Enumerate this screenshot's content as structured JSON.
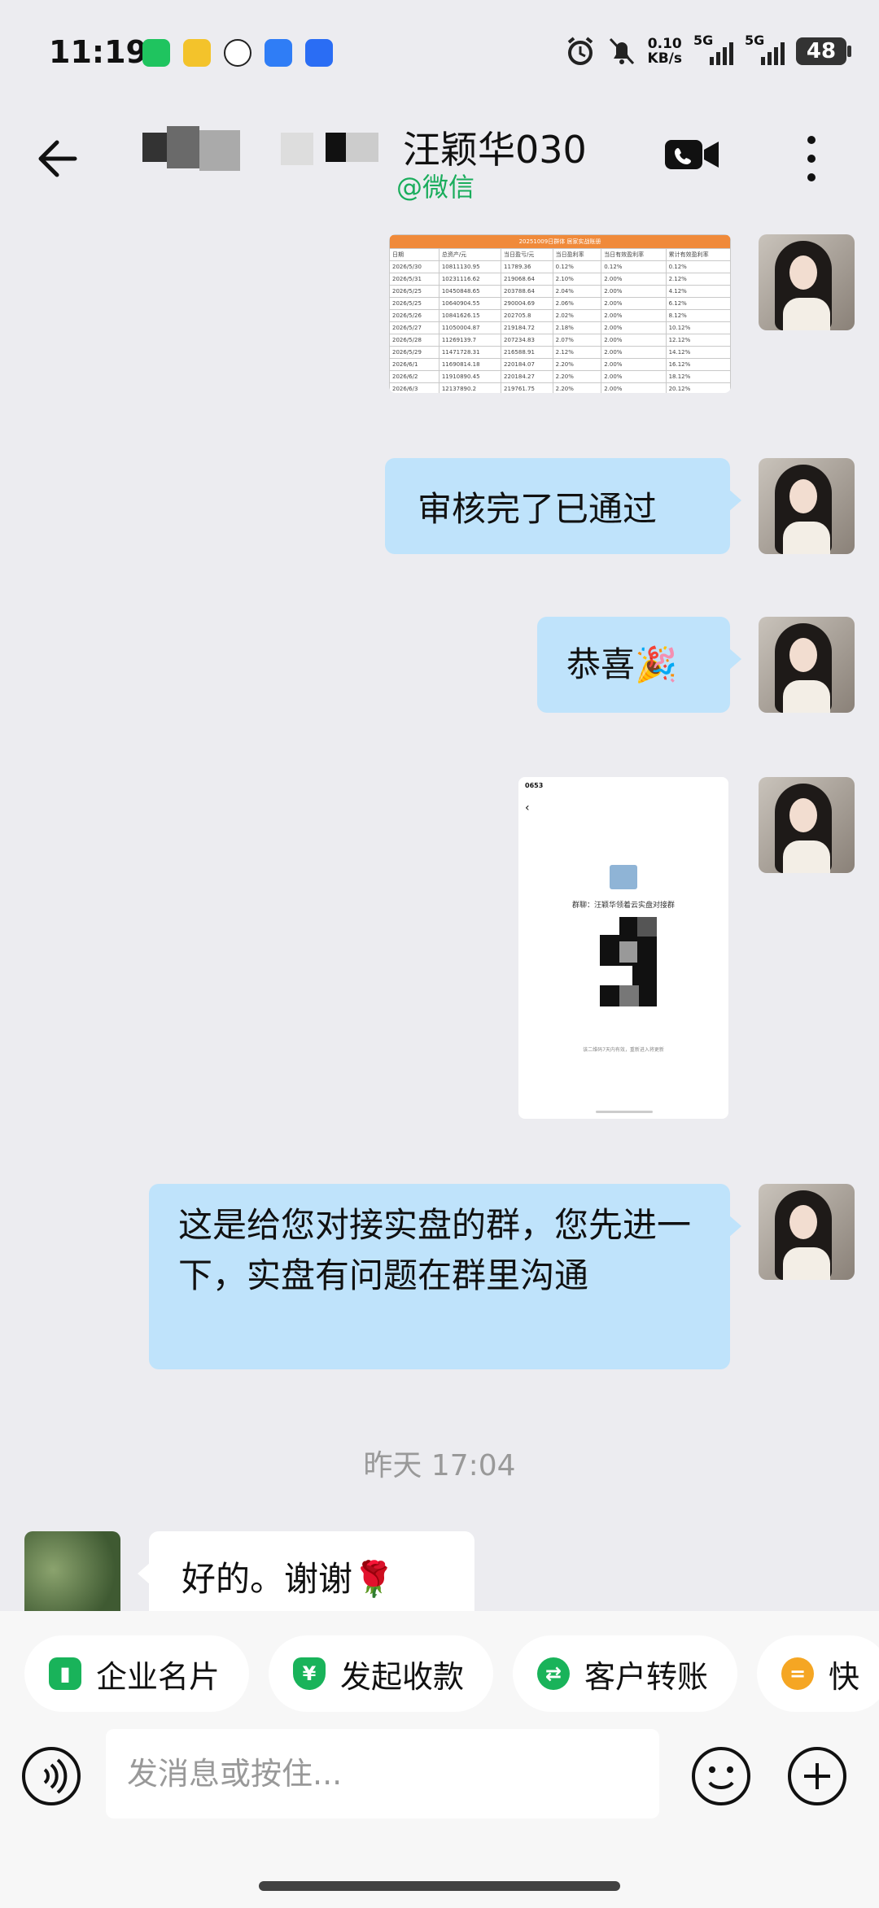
{
  "status": {
    "time": "11:19",
    "net_speed_value": "0.10",
    "net_speed_unit": "KB/s",
    "sig1_label": "5G",
    "sig2_label": "5G",
    "battery": "48"
  },
  "header": {
    "title": "汪颖华030",
    "subtitle": "@微信"
  },
  "messages": [
    {
      "type": "image",
      "side": "right",
      "content": "spreadsheet-screenshot"
    },
    {
      "type": "text",
      "side": "right",
      "text": "审核完了已通过"
    },
    {
      "type": "text",
      "side": "right",
      "text": "恭喜🎉"
    },
    {
      "type": "image",
      "side": "right",
      "content": "group-qr-screenshot"
    },
    {
      "type": "text",
      "side": "right",
      "text": "这是给您对接实盘的群，您先进一下，实盘有问题在群里沟通"
    },
    {
      "type": "timestamp",
      "text": "昨天 17:04"
    },
    {
      "type": "text",
      "side": "left",
      "text": "好的。谢谢🌹"
    }
  ],
  "table_image": {
    "caption": "20251009日群体 居家实战账册",
    "headers": [
      "日期",
      "总资产/元",
      "当日盈亏/元",
      "当日盈利率",
      "当日有效盈利率",
      "累计有效盈利率"
    ],
    "rows": [
      [
        "2026/5/30",
        "10811130.95",
        "11789.36",
        "0.12%",
        "0.12%",
        "0.12%"
      ],
      [
        "2026/5/31",
        "10231116.62",
        "219068.64",
        "2.10%",
        "2.00%",
        "2.12%"
      ],
      [
        "2026/5/25",
        "10450848.65",
        "203788.64",
        "2.04%",
        "2.00%",
        "4.12%"
      ],
      [
        "2026/5/25",
        "10640904.55",
        "290004.69",
        "2.06%",
        "2.00%",
        "6.12%"
      ],
      [
        "2026/5/26",
        "10841626.15",
        "202705.8",
        "2.02%",
        "2.00%",
        "8.12%"
      ],
      [
        "2026/5/27",
        "11050004.87",
        "219184.72",
        "2.18%",
        "2.00%",
        "10.12%"
      ],
      [
        "2026/5/28",
        "11269139.7",
        "207234.83",
        "2.07%",
        "2.00%",
        "12.12%"
      ],
      [
        "2026/5/29",
        "11471728.31",
        "216588.91",
        "2.12%",
        "2.00%",
        "14.12%"
      ],
      [
        "2026/6/1",
        "11690814.18",
        "220184.07",
        "2.20%",
        "2.00%",
        "16.12%"
      ],
      [
        "2026/6/2",
        "11910890.45",
        "220184.27",
        "2.20%",
        "2.00%",
        "18.12%"
      ],
      [
        "2026/6/3",
        "12137890.2",
        "219761.75",
        "2.20%",
        "2.00%",
        "20.12%"
      ]
    ]
  },
  "qr_image": {
    "status_time": "0653",
    "group_label": "群聊：汪颖华领着云实盘对接群",
    "footer": "该二维码7天内有效，重新进入将更新"
  },
  "quick_actions": [
    {
      "label": "企业名片",
      "icon": "card-icon",
      "color": "#19b35a"
    },
    {
      "label": "发起收款",
      "icon": "yen-shield-icon",
      "color": "#19b35a"
    },
    {
      "label": "客户转账",
      "icon": "transfer-icon",
      "color": "#19b35a"
    },
    {
      "label": "快",
      "icon": "quick-reply-icon",
      "color": "#f5a623"
    }
  ],
  "input": {
    "placeholder": "发消息或按住..."
  }
}
